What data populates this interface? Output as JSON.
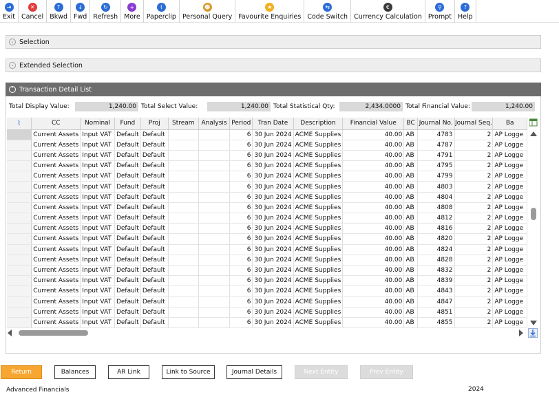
{
  "toolbar": [
    {
      "name": "exit-button",
      "icon": "exit-arrow-icon",
      "label": "Exit",
      "color": "#2b6cd6",
      "glyph": "⇥"
    },
    {
      "name": "cancel-button",
      "icon": "cancel-icon",
      "label": "Cancel",
      "color": "#e23b3b",
      "glyph": "✕"
    },
    {
      "name": "backward-button",
      "icon": "arrow-up-icon",
      "label": "Bkwd",
      "color": "#2b6cd6",
      "glyph": "↑"
    },
    {
      "name": "forward-button",
      "icon": "arrow-down-icon",
      "label": "Fwd",
      "color": "#2b6cd6",
      "glyph": "↓"
    },
    {
      "name": "refresh-button",
      "icon": "refresh-icon",
      "label": "Refresh",
      "color": "#2b6cd6",
      "glyph": "↻"
    },
    {
      "name": "more-button",
      "icon": "plus-icon",
      "label": "More",
      "color": "#8a3bd1",
      "glyph": "+"
    },
    {
      "name": "paperclip-button",
      "icon": "paperclip-icon",
      "label": "Paperclip",
      "color": "#2b6cd6",
      "glyph": "⌇"
    },
    {
      "name": "personal-query-button",
      "icon": "person-icon",
      "label": "Personal Query",
      "color": "#d99a2b",
      "glyph": "☻"
    },
    {
      "name": "favourite-enquiries-button",
      "icon": "star-icon",
      "label": "Favourite Enquiries",
      "color": "#f2b01e",
      "glyph": "★"
    },
    {
      "name": "code-switch-button",
      "icon": "switch-arrows-icon",
      "label": "Code Switch",
      "color": "#2b6cd6",
      "glyph": "⇆"
    },
    {
      "name": "currency-calculation-button",
      "icon": "euro-icon",
      "label": "Currency Calculation",
      "color": "#3a3a3a",
      "glyph": "€"
    },
    {
      "name": "prompt-button",
      "icon": "magnifier-icon",
      "label": "Prompt",
      "color": "#2b6cd6",
      "glyph": "⚲"
    },
    {
      "name": "help-button",
      "icon": "question-icon",
      "label": "Help",
      "color": "#2b6cd6",
      "glyph": "?"
    }
  ],
  "panels": {
    "selection": "Selection",
    "extended_selection": "Extended Selection",
    "transaction_detail": "Transaction Detail List"
  },
  "totals": {
    "display_label": "Total Display Value:",
    "display_value": "1,240.00",
    "select_label": "Total Select Value:",
    "select_value": "1,240.00",
    "stat_label": "Total Statistical Qty:",
    "stat_value": "2,434.0000",
    "financial_label": "Total Financial Value:",
    "financial_value": "1,240.00"
  },
  "columns": [
    "",
    "CC",
    "Nominal",
    "Fund",
    "Proj",
    "Stream",
    "Analysis",
    "Period",
    "Tran Date",
    "Description",
    "Financial Value",
    "BC",
    "Journal No.",
    "Journal Seq.",
    "Ba"
  ],
  "rows": [
    [
      "Current Assets",
      "Input VAT",
      "Default",
      "Default",
      "",
      "",
      "6",
      "30 Jun 2024",
      "ACME Supplies",
      "40.00",
      "AB",
      "4783",
      "2",
      "AP Logge"
    ],
    [
      "Current Assets",
      "Input VAT",
      "Default",
      "Default",
      "",
      "",
      "6",
      "30 Jun 2024",
      "ACME Supplies",
      "40.00",
      "AB",
      "4787",
      "2",
      "AP Logge"
    ],
    [
      "Current Assets",
      "Input VAT",
      "Default",
      "Default",
      "",
      "",
      "6",
      "30 Jun 2024",
      "ACME Supplies",
      "40.00",
      "AB",
      "4791",
      "2",
      "AP Logge"
    ],
    [
      "Current Assets",
      "Input VAT",
      "Default",
      "Default",
      "",
      "",
      "6",
      "30 Jun 2024",
      "ACME Supplies",
      "40.00",
      "AB",
      "4795",
      "2",
      "AP Logge"
    ],
    [
      "Current Assets",
      "Input VAT",
      "Default",
      "Default",
      "",
      "",
      "6",
      "30 Jun 2024",
      "ACME Supplies",
      "40.00",
      "AB",
      "4799",
      "2",
      "AP Logge"
    ],
    [
      "Current Assets",
      "Input VAT",
      "Default",
      "Default",
      "",
      "",
      "6",
      "30 Jun 2024",
      "ACME Supplies",
      "40.00",
      "AB",
      "4803",
      "2",
      "AP Logge"
    ],
    [
      "Current Assets",
      "Input VAT",
      "Default",
      "Default",
      "",
      "",
      "6",
      "30 Jun 2024",
      "ACME Supplies",
      "40.00",
      "AB",
      "4804",
      "2",
      "AP Logge"
    ],
    [
      "Current Assets",
      "Input VAT",
      "Default",
      "Default",
      "",
      "",
      "6",
      "30 Jun 2024",
      "ACME Supplies",
      "40.00",
      "AB",
      "4808",
      "2",
      "AP Logge"
    ],
    [
      "Current Assets",
      "Input VAT",
      "Default",
      "Default",
      "",
      "",
      "6",
      "30 Jun 2024",
      "ACME Supplies",
      "40.00",
      "AB",
      "4812",
      "2",
      "AP Logge"
    ],
    [
      "Current Assets",
      "Input VAT",
      "Default",
      "Default",
      "",
      "",
      "6",
      "30 Jun 2024",
      "ACME Supplies",
      "40.00",
      "AB",
      "4816",
      "2",
      "AP Logge"
    ],
    [
      "Current Assets",
      "Input VAT",
      "Default",
      "Default",
      "",
      "",
      "6",
      "30 Jun 2024",
      "ACME Supplies",
      "40.00",
      "AB",
      "4820",
      "2",
      "AP Logge"
    ],
    [
      "Current Assets",
      "Input VAT",
      "Default",
      "Default",
      "",
      "",
      "6",
      "30 Jun 2024",
      "ACME Supplies",
      "40.00",
      "AB",
      "4824",
      "2",
      "AP Logge"
    ],
    [
      "Current Assets",
      "Input VAT",
      "Default",
      "Default",
      "",
      "",
      "6",
      "30 Jun 2024",
      "ACME Supplies",
      "40.00",
      "AB",
      "4828",
      "2",
      "AP Logge"
    ],
    [
      "Current Assets",
      "Input VAT",
      "Default",
      "Default",
      "",
      "",
      "6",
      "30 Jun 2024",
      "ACME Supplies",
      "40.00",
      "AB",
      "4832",
      "2",
      "AP Logge"
    ],
    [
      "Current Assets",
      "Input VAT",
      "Default",
      "Default",
      "",
      "",
      "6",
      "30 Jun 2024",
      "ACME Supplies",
      "40.00",
      "AB",
      "4839",
      "2",
      "AP Logge"
    ],
    [
      "Current Assets",
      "Input VAT",
      "Default",
      "Default",
      "",
      "",
      "6",
      "30 Jun 2024",
      "ACME Supplies",
      "40.00",
      "AB",
      "4843",
      "2",
      "AP Logge"
    ],
    [
      "Current Assets",
      "Input VAT",
      "Default",
      "Default",
      "",
      "",
      "6",
      "30 Jun 2024",
      "ACME Supplies",
      "40.00",
      "AB",
      "4847",
      "2",
      "AP Logge"
    ],
    [
      "Current Assets",
      "Input VAT",
      "Default",
      "Default",
      "",
      "",
      "6",
      "30 Jun 2024",
      "ACME Supplies",
      "40.00",
      "AB",
      "4851",
      "2",
      "AP Logge"
    ],
    [
      "Current Assets",
      "Input VAT",
      "Default",
      "Default",
      "",
      "",
      "6",
      "30 Jun 2024",
      "ACME Supplies",
      "40.00",
      "AB",
      "4855",
      "2",
      "AP Logge"
    ]
  ],
  "buttons": {
    "return": "Return",
    "balances": "Balances",
    "ar_link": "AR Link",
    "link_to_source": "Link to Source",
    "journal_details": "Journal Details",
    "next_entity": "Next Entity",
    "prev_entity": "Prev Entity"
  },
  "footer": {
    "app_name": "Advanced Financials",
    "year": "2024"
  }
}
